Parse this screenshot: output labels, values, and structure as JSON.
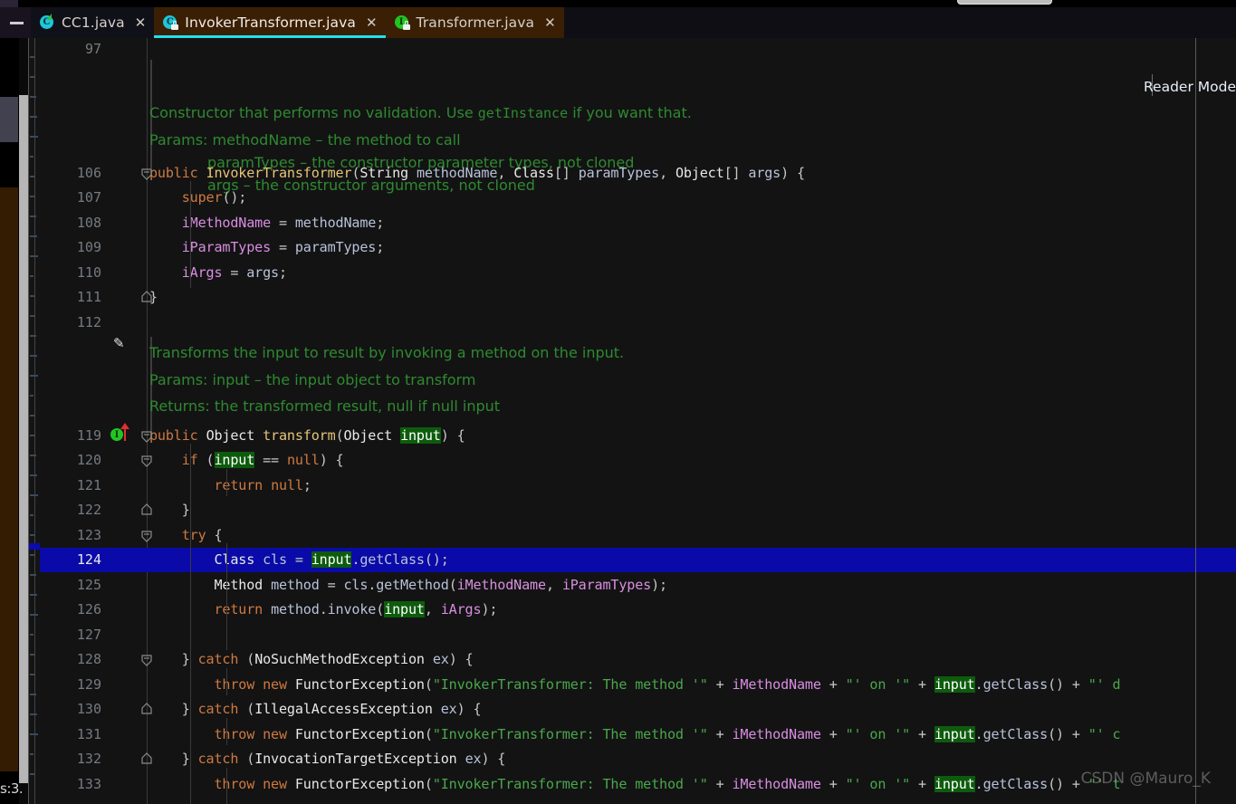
{
  "window": {
    "minimize_label": "—",
    "reader_mode_label": "Reader Mode",
    "watermark": "CSDN @Mauro_K",
    "status_fragment": "s:3.",
    "accent_color": "#23e0e8",
    "active_tab_bg": "#3a1f04",
    "selection_color": "#0a0aa8",
    "usage_highlight_color": "#0d5c0d"
  },
  "tabs": [
    {
      "label": "CC1.java",
      "icon": "java-class-icon",
      "active": false,
      "close_label": "✕"
    },
    {
      "label": "InvokerTransformer.java",
      "icon": "java-class-locked-icon",
      "active": true,
      "close_label": "✕"
    },
    {
      "label": "Transformer.java",
      "icon": "java-interface-locked-icon",
      "active": false,
      "close_label": "✕"
    }
  ],
  "editor": {
    "first_visible_line": "97",
    "doc_blocks": [
      {
        "lines": [
          "Constructor that performs no validation. Use ",
          "getInstance",
          " if you want that."
        ],
        "params_label": "Params:",
        "params": [
          "methodName – the method to call",
          "paramTypes – the constructor parameter types, not cloned",
          "args – the constructor arguments, not cloned"
        ]
      },
      {
        "summary": "Transforms the input to result by invoking a method on the input.",
        "params_label": "Params:",
        "params": [
          "input – the input object to transform"
        ],
        "returns_label": "Returns:",
        "returns": "the transformed result, null if null input"
      }
    ],
    "lines": [
      {
        "num": "106",
        "text": "public InvokerTransformer(String methodName, Class[] paramTypes, Object[] args) {"
      },
      {
        "num": "107",
        "text": "    super();"
      },
      {
        "num": "108",
        "text": "    iMethodName = methodName;"
      },
      {
        "num": "109",
        "text": "    iParamTypes = paramTypes;"
      },
      {
        "num": "110",
        "text": "    iArgs = args;"
      },
      {
        "num": "111",
        "text": "}"
      },
      {
        "num": "112",
        "text": ""
      },
      {
        "num": "119",
        "text": "public Object transform(Object input) {"
      },
      {
        "num": "120",
        "text": "    if (input == null) {"
      },
      {
        "num": "121",
        "text": "        return null;"
      },
      {
        "num": "122",
        "text": "    }"
      },
      {
        "num": "123",
        "text": "    try {"
      },
      {
        "num": "124",
        "text": "        Class cls = input.getClass();"
      },
      {
        "num": "125",
        "text": "        Method method = cls.getMethod(iMethodName, iParamTypes);"
      },
      {
        "num": "126",
        "text": "        return method.invoke(input, iArgs);"
      },
      {
        "num": "127",
        "text": ""
      },
      {
        "num": "128",
        "text": "    } catch (NoSuchMethodException ex) {"
      },
      {
        "num": "129",
        "text": "        throw new FunctorException(\"InvokerTransformer: The method '\" + iMethodName + \"' on '\" + input.getClass() + \"' d"
      },
      {
        "num": "130",
        "text": "    } catch (IllegalAccessException ex) {"
      },
      {
        "num": "131",
        "text": "        throw new FunctorException(\"InvokerTransformer: The method '\" + iMethodName + \"' on '\" + input.getClass() + \"' c"
      },
      {
        "num": "132",
        "text": "    } catch (InvocationTargetException ex) {"
      },
      {
        "num": "133",
        "text": "        throw new FunctorException(\"InvokerTransformer: The method '\" + iMethodName + \"' on '\" + input.getClass() + \"' t"
      }
    ],
    "selected_line": "124",
    "implemented_marker_line": "119"
  }
}
